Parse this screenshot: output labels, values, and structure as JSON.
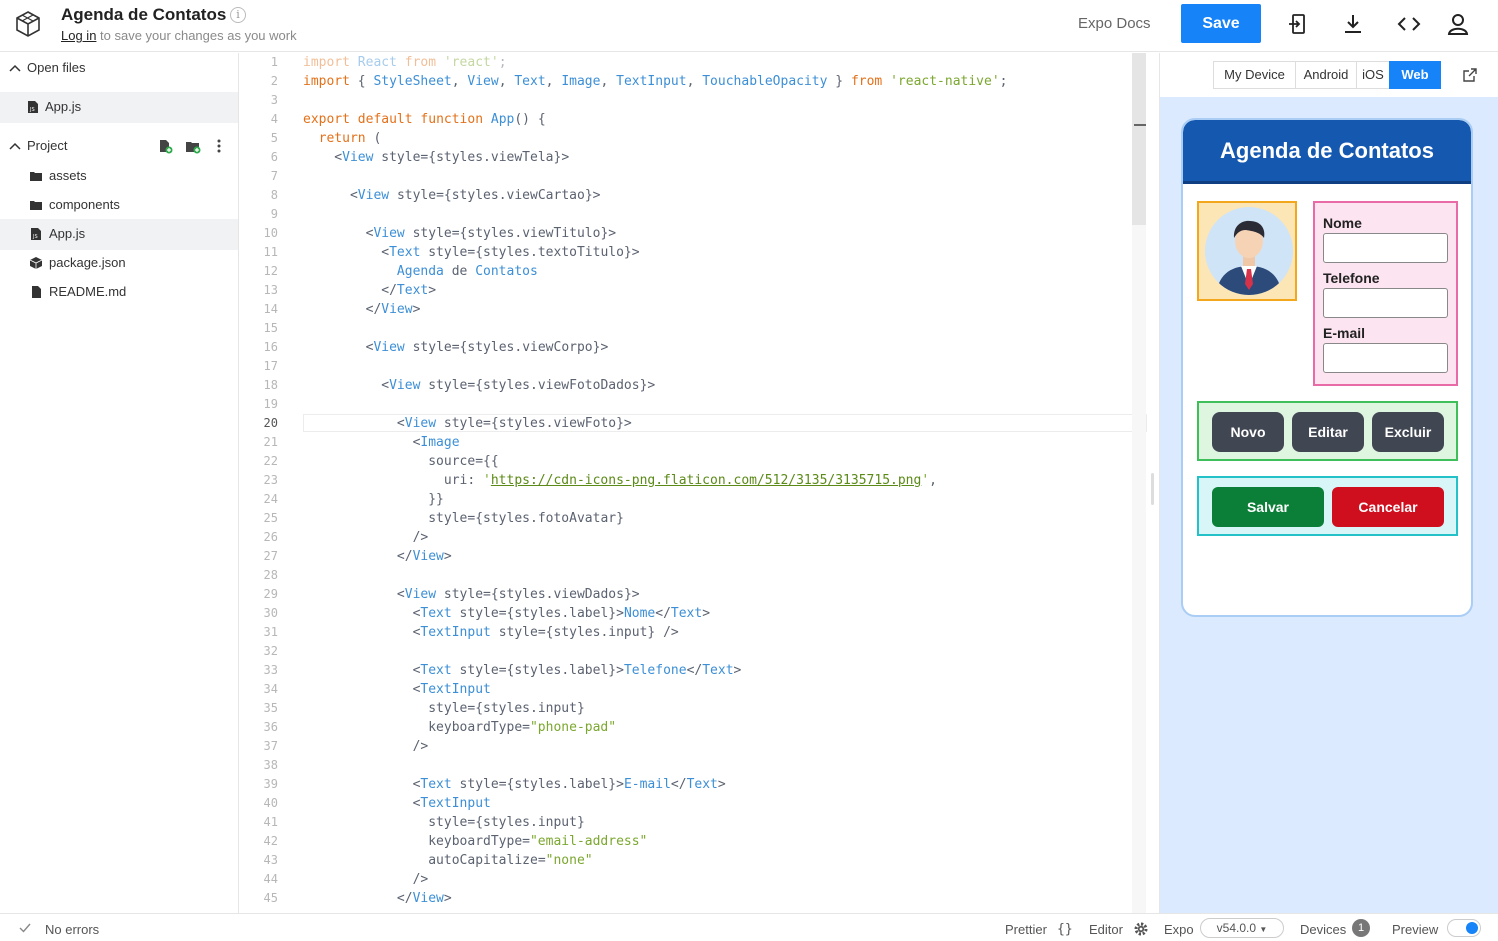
{
  "header": {
    "title": "Agenda de Contatos",
    "login_link": "Log in",
    "subtitle_rest": " to save your changes as you work",
    "docs_link": "Expo Docs",
    "save_label": "Save",
    "icons": [
      "snack-logo-icon",
      "info-icon",
      "export-icon",
      "download-icon",
      "code-icon",
      "user-icon"
    ]
  },
  "sidebar": {
    "open_files_label": "Open files",
    "open_files": [
      {
        "name": "App.js"
      }
    ],
    "project_label": "Project",
    "project_items": [
      {
        "name": "assets",
        "type": "folder"
      },
      {
        "name": "components",
        "type": "folder"
      },
      {
        "name": "App.js",
        "type": "file-js"
      },
      {
        "name": "package.json",
        "type": "package"
      },
      {
        "name": "README.md",
        "type": "file"
      }
    ]
  },
  "editor": {
    "line_numbers": [
      "1",
      "2",
      "3",
      "4",
      "5",
      "6",
      "7",
      "8",
      "9",
      "10",
      "11",
      "12",
      "13",
      "14",
      "15",
      "16",
      "17",
      "18",
      "19",
      "20",
      "21",
      "22",
      "23",
      "24",
      "25",
      "26",
      "27",
      "28",
      "29",
      "30",
      "31",
      "32",
      "33",
      "34",
      "35",
      "36",
      "37",
      "38",
      "39",
      "40",
      "41",
      "42",
      "43",
      "44",
      "45"
    ],
    "current_line": "20",
    "lines": [
      "import React from 'react';",
      "import { StyleSheet, View, Text, Image, TextInput, TouchableOpacity } from 'react-native';",
      "",
      "export default function App() {",
      "  return (",
      "    <View style={styles.viewTela}>",
      "",
      "      <View style={styles.viewCartao}>",
      "",
      "        <View style={styles.viewTitulo}>",
      "          <Text style={styles.textoTitulo}>",
      "            Agenda de Contatos",
      "          </Text>",
      "        </View>",
      "",
      "        <View style={styles.viewCorpo}>",
      "",
      "          <View style={styles.viewFotoDados}>",
      "",
      "            <View style={styles.viewFoto}>",
      "              <Image",
      "                source={{",
      "                  uri: 'https://cdn-icons-png.flaticon.com/512/3135/3135715.png',",
      "                }}",
      "                style={styles.fotoAvatar}",
      "              />",
      "            </View>",
      "",
      "            <View style={styles.viewDados}>",
      "              <Text style={styles.label}>Nome</Text>",
      "              <TextInput style={styles.input} />",
      "",
      "              <Text style={styles.label}>Telefone</Text>",
      "              <TextInput",
      "                style={styles.input}",
      "                keyboardType=\"phone-pad\"",
      "              />",
      "",
      "              <Text style={styles.label}>E-mail</Text>",
      "              <TextInput",
      "                style={styles.input}",
      "                keyboardType=\"email-address\"",
      "                autoCapitalize=\"none\"",
      "              />",
      "            </View>"
    ]
  },
  "preview": {
    "tabs": [
      {
        "label": "My Device",
        "active": false
      },
      {
        "label": "Android",
        "active": false
      },
      {
        "label": "iOS",
        "active": false
      },
      {
        "label": "Web",
        "active": true
      }
    ],
    "app": {
      "title": "Agenda de Contatos",
      "fields": [
        {
          "label": "Nome",
          "value": ""
        },
        {
          "label": "Telefone",
          "value": ""
        },
        {
          "label": "E-mail",
          "value": ""
        }
      ],
      "action_buttons": [
        "Novo",
        "Editar",
        "Excluir"
      ],
      "save_label": "Salvar",
      "cancel_label": "Cancelar"
    },
    "colors": {
      "title_bar": "#1558b0",
      "save": "#0b7f37",
      "cancel": "#cf0f1e",
      "action_button": "#404652",
      "background": "#dbeafe"
    }
  },
  "statusbar": {
    "errors_label": "No errors",
    "prettier_label": "Prettier",
    "prettier_icon": "{}",
    "editor_label": "Editor",
    "expo_label": "Expo",
    "version": "v54.0.0",
    "devices_label": "Devices",
    "devices_count": "1",
    "preview_label": "Preview"
  }
}
